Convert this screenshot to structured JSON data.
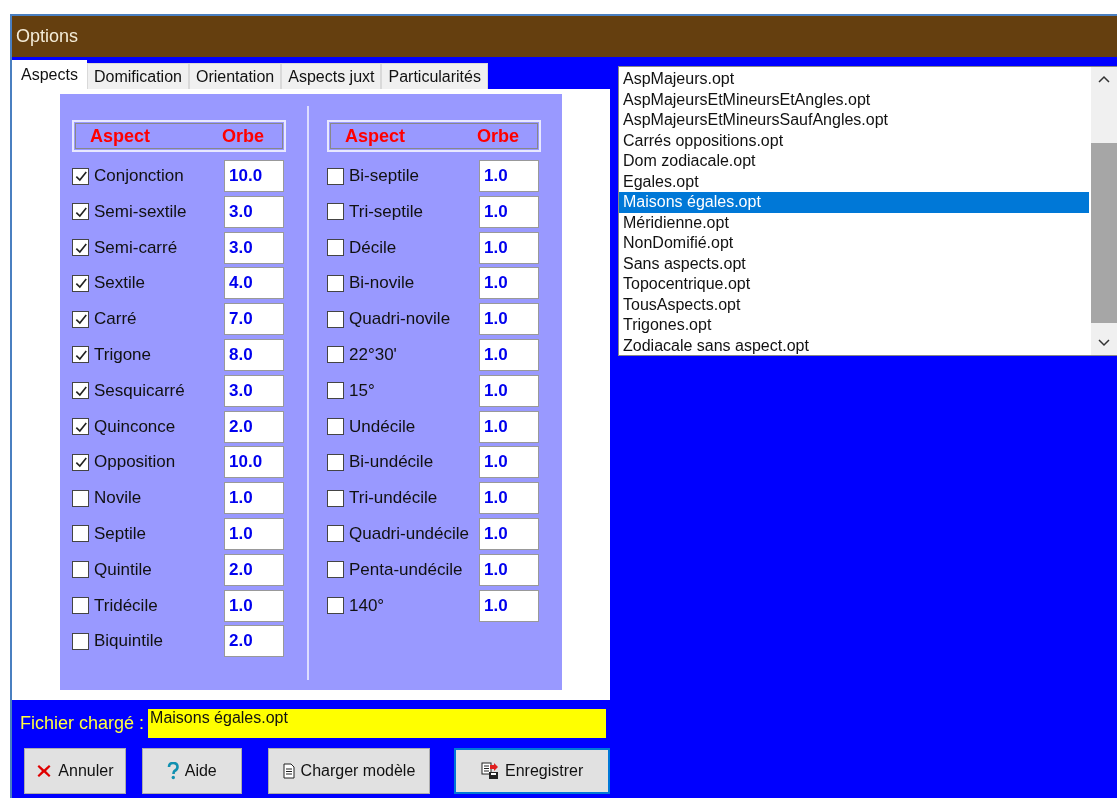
{
  "window": {
    "title": "Options"
  },
  "tabs": [
    {
      "label": "Aspects",
      "selected": true
    },
    {
      "label": "Domification",
      "selected": false
    },
    {
      "label": "Orientation",
      "selected": false
    },
    {
      "label": "Aspects juxt",
      "selected": false
    },
    {
      "label": "Particularités",
      "selected": false
    }
  ],
  "columns": [
    {
      "header": {
        "aspect": "Aspect",
        "orbe": "Orbe"
      },
      "rows": [
        {
          "label": "Conjonction",
          "checked": true,
          "orbe": "10.0"
        },
        {
          "label": "Semi-sextile",
          "checked": true,
          "orbe": "3.0"
        },
        {
          "label": "Semi-carré",
          "checked": true,
          "orbe": "3.0"
        },
        {
          "label": "Sextile",
          "checked": true,
          "orbe": "4.0"
        },
        {
          "label": "Carré",
          "checked": true,
          "orbe": "7.0"
        },
        {
          "label": "Trigone",
          "checked": true,
          "orbe": "8.0"
        },
        {
          "label": "Sesquicarré",
          "checked": true,
          "orbe": "3.0"
        },
        {
          "label": "Quinconce",
          "checked": true,
          "orbe": "2.0"
        },
        {
          "label": "Opposition",
          "checked": true,
          "orbe": "10.0"
        },
        {
          "label": "Novile",
          "checked": false,
          "orbe": "1.0"
        },
        {
          "label": "Septile",
          "checked": false,
          "orbe": "1.0"
        },
        {
          "label": "Quintile",
          "checked": false,
          "orbe": "2.0"
        },
        {
          "label": "Tridécile",
          "checked": false,
          "orbe": "1.0"
        },
        {
          "label": "Biquintile",
          "checked": false,
          "orbe": "2.0"
        }
      ]
    },
    {
      "header": {
        "aspect": "Aspect",
        "orbe": "Orbe"
      },
      "rows": [
        {
          "label": "Bi-septile",
          "checked": false,
          "orbe": "1.0"
        },
        {
          "label": "Tri-septile",
          "checked": false,
          "orbe": "1.0"
        },
        {
          "label": "Décile",
          "checked": false,
          "orbe": "1.0"
        },
        {
          "label": "Bi-novile",
          "checked": false,
          "orbe": "1.0"
        },
        {
          "label": "Quadri-novile",
          "checked": false,
          "orbe": "1.0"
        },
        {
          "label": "22°30'",
          "checked": false,
          "orbe": "1.0"
        },
        {
          "label": "15°",
          "checked": false,
          "orbe": "1.0"
        },
        {
          "label": "Undécile",
          "checked": false,
          "orbe": "1.0"
        },
        {
          "label": "Bi-undécile",
          "checked": false,
          "orbe": "1.0"
        },
        {
          "label": "Tri-undécile",
          "checked": false,
          "orbe": "1.0"
        },
        {
          "label": "Quadri-undécile",
          "checked": false,
          "orbe": "1.0"
        },
        {
          "label": "Penta-undécile",
          "checked": false,
          "orbe": "1.0"
        },
        {
          "label": "140°",
          "checked": false,
          "orbe": "1.0"
        }
      ]
    }
  ],
  "files": [
    {
      "name": "AspMajeurs.opt",
      "selected": false
    },
    {
      "name": "AspMajeursEtMineursEtAngles.opt",
      "selected": false
    },
    {
      "name": "AspMajeursEtMineursSaufAngles.opt",
      "selected": false
    },
    {
      "name": "Carrés oppositions.opt",
      "selected": false
    },
    {
      "name": "Dom zodiacale.opt",
      "selected": false
    },
    {
      "name": "Egales.opt",
      "selected": false
    },
    {
      "name": "Maisons égales.opt",
      "selected": true
    },
    {
      "name": "Méridienne.opt",
      "selected": false
    },
    {
      "name": "NonDomifié.opt",
      "selected": false
    },
    {
      "name": "Sans aspects.opt",
      "selected": false
    },
    {
      "name": "Topocentrique.opt",
      "selected": false
    },
    {
      "name": "TousAspects.opt",
      "selected": false
    },
    {
      "name": "Trigones.opt",
      "selected": false
    },
    {
      "name": "Zodiacale sans aspect.opt",
      "selected": false
    }
  ],
  "loaded_file": {
    "label": "Fichier chargé :",
    "value": "Maisons égales.opt"
  },
  "buttons": [
    {
      "kind": "cancel",
      "label": "Annuler"
    },
    {
      "kind": "help",
      "label": "Aide"
    },
    {
      "kind": "load",
      "label": "Charger modèle"
    },
    {
      "kind": "save",
      "label": "Enregistrer"
    }
  ]
}
